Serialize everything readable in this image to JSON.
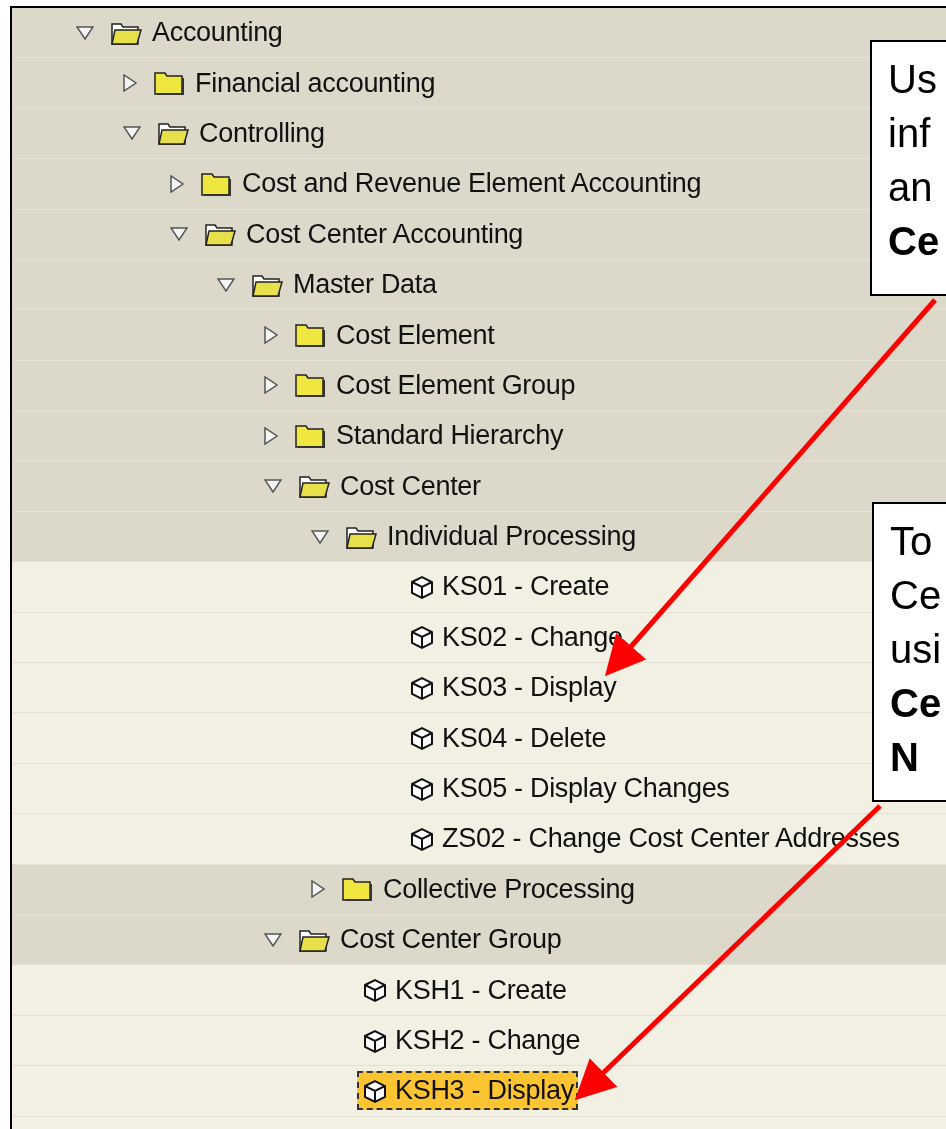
{
  "tree": [
    {
      "label": "Accounting",
      "kind": "folder",
      "expanded": true,
      "children": [
        {
          "label": "Financial accounting",
          "kind": "folder",
          "expanded": false
        },
        {
          "label": "Controlling",
          "kind": "folder",
          "expanded": true,
          "children": [
            {
              "label": "Cost and Revenue Element Accounting",
              "kind": "folder",
              "expanded": false
            },
            {
              "label": "Cost Center Accounting",
              "kind": "folder",
              "expanded": true,
              "children": [
                {
                  "label": "Master Data",
                  "kind": "folder",
                  "expanded": true,
                  "children": [
                    {
                      "label": "Cost Element",
                      "kind": "folder",
                      "expanded": false
                    },
                    {
                      "label": "Cost Element Group",
                      "kind": "folder",
                      "expanded": false
                    },
                    {
                      "label": "Standard Hierarchy",
                      "kind": "folder",
                      "expanded": false
                    },
                    {
                      "label": "Cost Center",
                      "kind": "folder",
                      "expanded": true,
                      "children": [
                        {
                          "label": "Individual Processing",
                          "kind": "folder",
                          "expanded": true,
                          "children": [
                            {
                              "label": "KS01 - Create",
                              "kind": "transaction",
                              "selected": false
                            },
                            {
                              "label": "KS02 - Change",
                              "kind": "transaction",
                              "selected": false
                            },
                            {
                              "label": "KS03 - Display",
                              "kind": "transaction",
                              "selected": false
                            },
                            {
                              "label": "KS04 - Delete",
                              "kind": "transaction",
                              "selected": false
                            },
                            {
                              "label": "KS05 - Display Changes",
                              "kind": "transaction",
                              "selected": false
                            },
                            {
                              "label": "ZS02 - Change Cost Center Addresses",
                              "kind": "transaction",
                              "selected": false
                            }
                          ]
                        },
                        {
                          "label": "Collective Processing",
                          "kind": "folder",
                          "expanded": false
                        }
                      ]
                    },
                    {
                      "label": "Cost Center Group",
                      "kind": "folder",
                      "expanded": true,
                      "children": [
                        {
                          "label": "KSH1 - Create",
                          "kind": "transaction",
                          "selected": false
                        },
                        {
                          "label": "KSH2 - Change",
                          "kind": "transaction",
                          "selected": false
                        },
                        {
                          "label": "KSH3 - Display",
                          "kind": "transaction",
                          "selected": true
                        }
                      ]
                    }
                  ]
                }
              ]
            }
          ]
        }
      ]
    }
  ],
  "callouts": [
    {
      "lines": [
        {
          "text": "Us",
          "bold": false
        },
        {
          "text": "inf",
          "bold": false
        },
        {
          "text": "an",
          "bold": false
        },
        {
          "text": "Ce",
          "bold": true
        }
      ]
    },
    {
      "lines": [
        {
          "text": "To",
          "bold": false
        },
        {
          "text": "Ce",
          "bold": false
        },
        {
          "text": "usi",
          "bold": false
        },
        {
          "text": "Ce",
          "bold": true
        },
        {
          "text": "N",
          "bold": true
        }
      ]
    }
  ]
}
